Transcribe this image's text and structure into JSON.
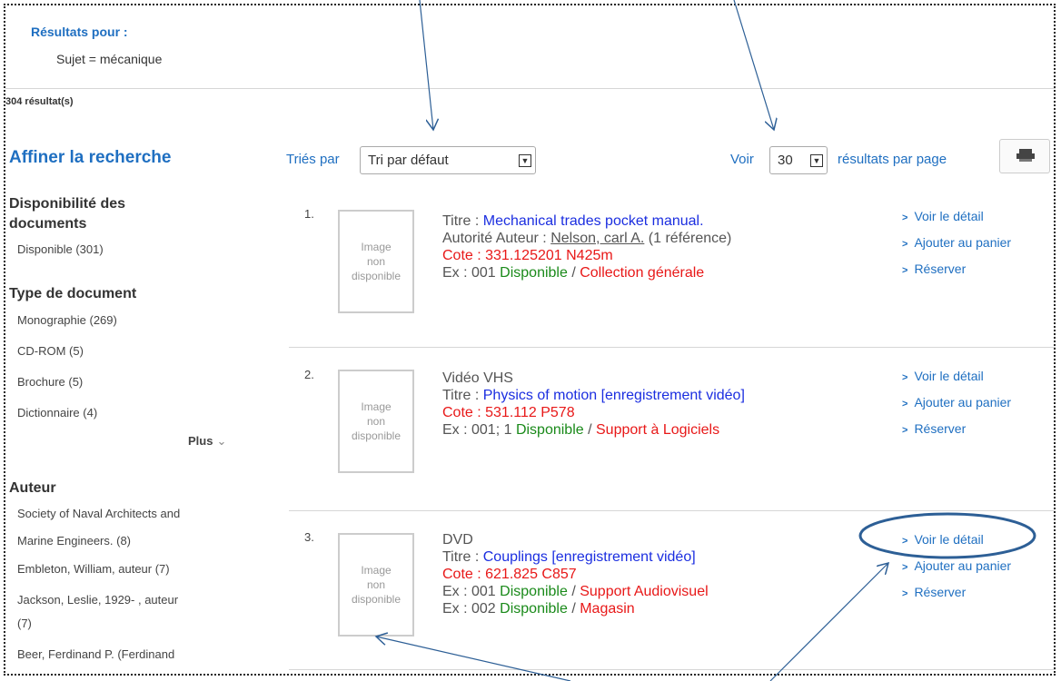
{
  "header": {
    "results_for": "Résultats pour :",
    "subject": "Sujet = mécanique",
    "count": "304 résultat(s)"
  },
  "sidebar": {
    "title": "Affiner la recherche",
    "availability": {
      "heading": "Disponibilité des documents",
      "items": [
        "Disponible (301)"
      ]
    },
    "doctype": {
      "heading": "Type de document",
      "items": [
        "Monographie (269)",
        "CD-ROM (5)",
        "Brochure (5)",
        "Dictionnaire (4)"
      ],
      "more": "Plus"
    },
    "author": {
      "heading": "Auteur",
      "items": [
        "Society of Naval Architects and",
        "Marine Engineers. (8)",
        "Embleton, William, auteur (7)",
        "Jackson, Leslie, 1929- , auteur",
        "(7)",
        "Beer, Ferdinand P. (Ferdinand"
      ]
    }
  },
  "toolbar": {
    "sort_label": "Triés par",
    "sort_value": "Tri par défaut",
    "show_label": "Voir",
    "per_page_value": "30",
    "per_page_label": "résultats par page",
    "print_icon": "printer-icon"
  },
  "thumb_text": [
    "Image",
    "non",
    "disponible"
  ],
  "actions": {
    "detail": "Voir le détail",
    "cart": "Ajouter au panier",
    "reserve": "Réserver"
  },
  "results": [
    {
      "num": "1.",
      "title_label": "Titre : ",
      "title": "Mechanical trades pocket manual.",
      "author_label": "Autorité Auteur : ",
      "author": "Nelson, carl A.",
      "author_refs": " (1 référence)",
      "cote": "Cote : 331.125201 N425m",
      "ex": [
        {
          "label": "Ex : 001 ",
          "status": "Disponible",
          "sep": " / ",
          "location": "Collection générale"
        }
      ]
    },
    {
      "num": "2.",
      "type": "Vidéo VHS",
      "title_label": "Titre : ",
      "title": "Physics of motion [enregistrement vidéo]",
      "cote": "Cote : 531.112 P578",
      "ex": [
        {
          "label": "Ex : 001; 1 ",
          "status": "Disponible",
          "sep": " / ",
          "location": "Support à Logiciels"
        }
      ]
    },
    {
      "num": "3.",
      "type": "DVD",
      "title_label": "Titre : ",
      "title": "Couplings [enregistrement vidéo]",
      "cote": "Cote : 621.825 C857",
      "ex": [
        {
          "label": "Ex : 001 ",
          "status": "Disponible",
          "sep": " / ",
          "location": "Support Audiovisuel"
        },
        {
          "label": "Ex : 002 ",
          "status": "Disponible",
          "sep": " / ",
          "location": "Magasin"
        }
      ]
    }
  ],
  "colors": {
    "link": "#1f6fc1",
    "title": "#1b2ee0",
    "cote": "#e81818",
    "available": "#1a8a1a",
    "annotation": "#2d5f96"
  }
}
